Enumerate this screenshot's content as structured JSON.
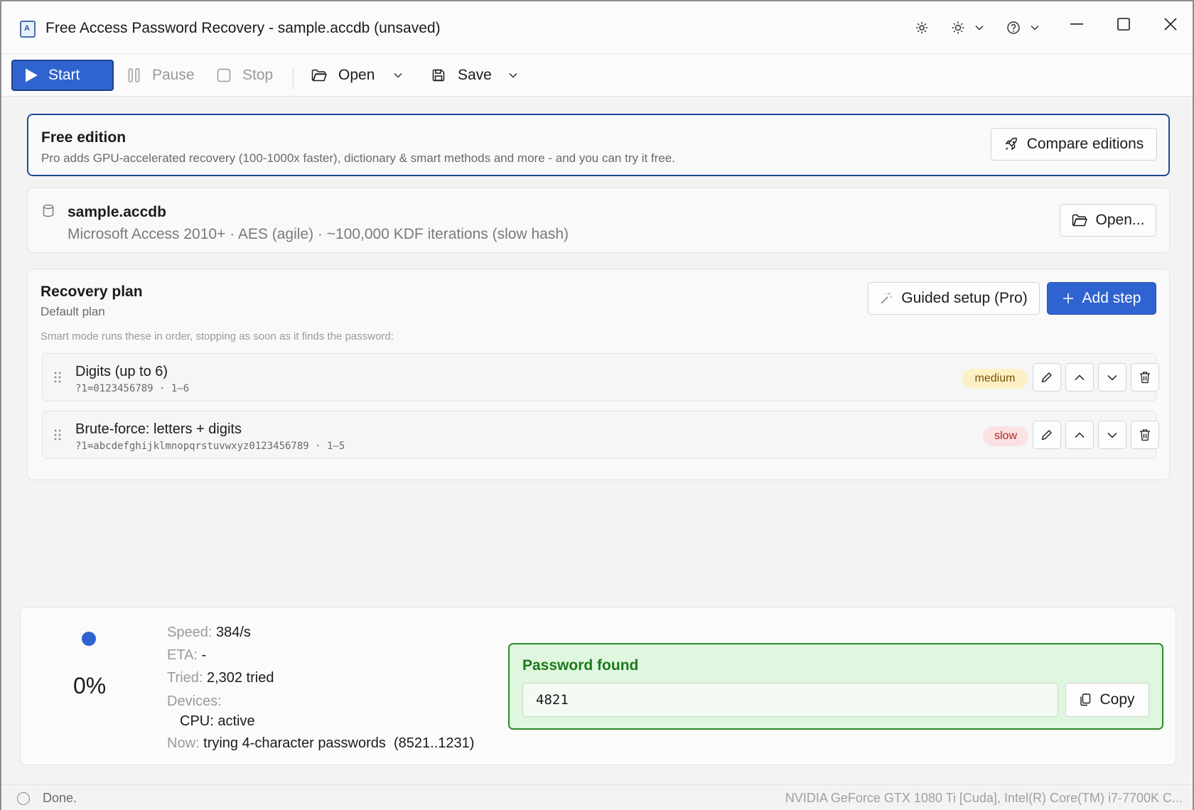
{
  "window": {
    "title": "Free Access Password Recovery - sample.accdb (unsaved)"
  },
  "titlebar_icons": [
    "gear-icon",
    "sun-icon",
    "help-icon"
  ],
  "toolbar": {
    "start": "Start",
    "pause": "Pause",
    "stop": "Stop",
    "open": "Open",
    "save": "Save"
  },
  "edition": {
    "title": "Free edition",
    "description": "Pro adds GPU-accelerated recovery (100-1000x faster), dictionary & smart methods and more - and you can try it free.",
    "compare_button": "Compare editions"
  },
  "file": {
    "name": "sample.accdb",
    "description": "Microsoft Access 2010+ · AES (agile) · ~100,000 KDF iterations (slow hash)",
    "open_button": "Open..."
  },
  "plan": {
    "title": "Recovery plan",
    "subtitle": "Default plan",
    "hint": "Smart mode runs these in order, stopping as soon as it finds the password:",
    "guided_button": "Guided setup (Pro)",
    "add_button": "Add step",
    "steps": [
      {
        "name": "Digits (up to 6)",
        "mask": "?1=0123456789 · 1–6",
        "speed": "medium"
      },
      {
        "name": "Brute-force: letters + digits",
        "mask": "?1=abcdefghijklmnopqrstuvwxyz0123456789 · 1–5",
        "speed": "slow"
      }
    ]
  },
  "status": {
    "percent": "0%",
    "speed_label": "Speed:",
    "speed_value": "384/s",
    "eta_label": "ETA:",
    "eta_value": "-",
    "tried_label": "Tried:",
    "tried_value": "2,302 tried",
    "devices_label": "Devices:",
    "cpu_value": "CPU: active",
    "now_label": "Now:",
    "now_value": "trying 4-character passwords  (8521..1231)"
  },
  "found": {
    "title": "Password found",
    "password": "4821",
    "copy_button": "Copy"
  },
  "statusbar": {
    "text": "Done.",
    "devices": "NVIDIA GeForce GTX 1080 Ti [Cuda], Intel(R) Core(TM) i7-7700K C..."
  },
  "colors": {
    "accent": "#2f63d0",
    "success": "#2e8b2e",
    "badge_medium": "#fdf0c4",
    "badge_slow": "#fbe2e2"
  }
}
